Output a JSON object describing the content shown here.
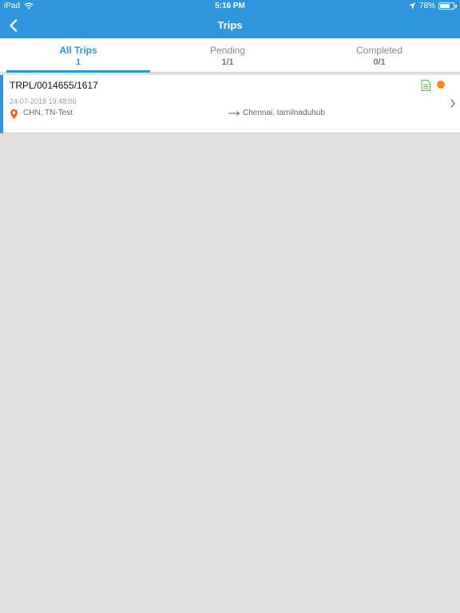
{
  "status_bar": {
    "device": "iPad",
    "time": "5:16 PM",
    "battery": "78%",
    "battery_level": 0.78
  },
  "nav": {
    "title": "Trips",
    "back_icon": "chevron-left-icon"
  },
  "tabs": [
    {
      "label": "All Trips",
      "count": "1",
      "active": true
    },
    {
      "label": "Pending",
      "count": "1/1",
      "active": false
    },
    {
      "label": "Completed",
      "count": "0/1",
      "active": false
    }
  ],
  "trips": [
    {
      "id": "TRPL/0014655/1617",
      "datetime": "24-07-2018 19:48:00",
      "origin": "CHN, TN-Test",
      "destination": "Chennai, tamilnaduhub",
      "status_color": "#f28c1b",
      "doc_icon": "document-icon"
    }
  ],
  "colors": {
    "primary": "#2f96dc",
    "status_pending": "#f28c1b",
    "doc_green": "#5cb85c",
    "pin_orange": "#f26522"
  }
}
